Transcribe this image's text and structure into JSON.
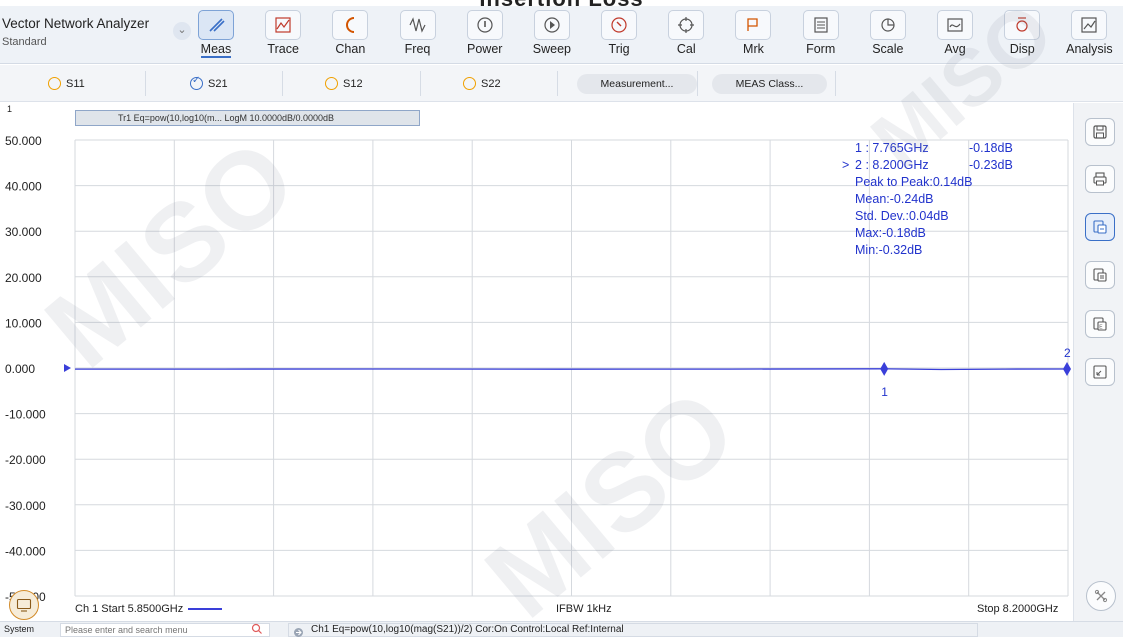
{
  "page_heading": "Insertion Loss",
  "app": {
    "title": "Vector Network Analyzer",
    "subtitle": "Standard"
  },
  "toolbar": {
    "items": [
      {
        "label": "Meas",
        "icon": "meas-icon",
        "active": true
      },
      {
        "label": "Trace",
        "icon": "trace-icon"
      },
      {
        "label": "Chan",
        "icon": "chan-icon"
      },
      {
        "label": "Freq",
        "icon": "freq-icon"
      },
      {
        "label": "Power",
        "icon": "power-icon"
      },
      {
        "label": "Sweep",
        "icon": "sweep-icon"
      },
      {
        "label": "Trig",
        "icon": "trig-icon"
      },
      {
        "label": "Cal",
        "icon": "cal-icon"
      },
      {
        "label": "Mrk",
        "icon": "mrk-icon"
      },
      {
        "label": "Form",
        "icon": "form-icon"
      },
      {
        "label": "Scale",
        "icon": "scale-icon"
      },
      {
        "label": "Avg",
        "icon": "avg-icon"
      },
      {
        "label": "Disp",
        "icon": "disp-icon"
      },
      {
        "label": "Analysis",
        "icon": "analysis-icon"
      }
    ]
  },
  "measurements": {
    "s11": "S11",
    "s21": "S21",
    "s12": "S12",
    "s22": "S22",
    "selected": "S21",
    "measurement_button": "Measurement...",
    "meas_class_button": "MEAS Class..."
  },
  "trace": {
    "number": "1",
    "tab_label": "Tr1 Eq=pow(10,log10(m... LogM 10.0000dB/0.0000dB"
  },
  "markers": {
    "rows": [
      {
        "prefix": "",
        "id": "1",
        "freq": ": 7.765GHz",
        "value": "-0.18dB"
      },
      {
        "prefix": ">",
        "id": "2",
        "freq": ": 8.200GHz",
        "value": "-0.23dB"
      }
    ],
    "stats": [
      "Peak to Peak:0.14dB",
      "Mean:-0.24dB",
      "Std. Dev.:0.04dB",
      "Max:-0.18dB",
      "Min:-0.32dB"
    ],
    "marker_labels": [
      "1",
      "2"
    ]
  },
  "chart_data": {
    "type": "line",
    "title": "",
    "xlabel": "",
    "ylabel": "",
    "y_ticks": [
      "50.000",
      "40.000",
      "30.000",
      "20.000",
      "10.000",
      "0.000",
      "-10.000",
      "-20.000",
      "-30.000",
      "-40.000",
      "-50.000"
    ],
    "ylim": [
      -50,
      50
    ],
    "xlim_ghz": [
      5.85,
      8.2
    ],
    "grid": true,
    "series": [
      {
        "name": "Tr1",
        "color": "#3a3fd9",
        "x": [
          5.85,
          6.2,
          6.6,
          7.0,
          7.4,
          7.765,
          7.9,
          8.05,
          8.2
        ],
        "y": [
          -0.24,
          -0.25,
          -0.22,
          -0.26,
          -0.24,
          -0.18,
          -0.32,
          -0.24,
          -0.23
        ]
      }
    ],
    "markers": [
      {
        "id": "1",
        "x": 7.765,
        "y": -0.18
      },
      {
        "id": "2",
        "x": 8.2,
        "y": -0.23
      }
    ]
  },
  "footer": {
    "start": "Ch 1 Start 5.8500GHz",
    "ifbw": "IFBW 1kHz",
    "stop": "Stop 8.2000GHz"
  },
  "status": {
    "system_label": "System",
    "search_placeholder": "Please enter and search menu",
    "info": "Ch1 Eq=pow(10,log10(mag(S21))/2) Cor:On Control:Local Ref:Internal"
  },
  "colors": {
    "trace": "#3a3fd9",
    "marker_text": "#2233cc",
    "accent": "#3a6fc7"
  },
  "watermark": "MISO"
}
